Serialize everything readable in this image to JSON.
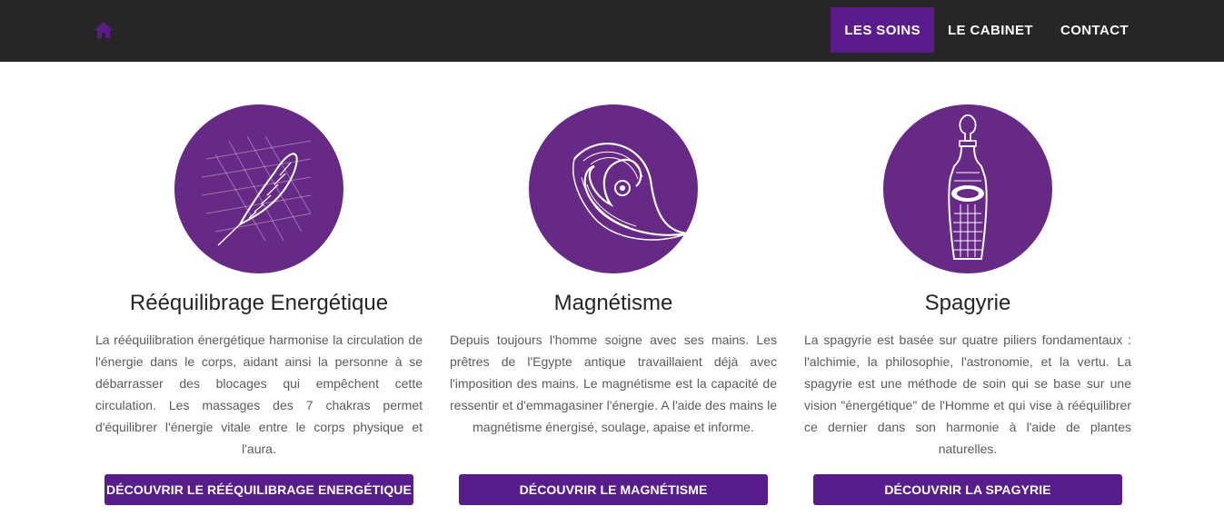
{
  "nav": {
    "home_icon": "home-icon",
    "items": [
      {
        "label": "LES SOINS",
        "active": true
      },
      {
        "label": "LE CABINET",
        "active": false
      },
      {
        "label": "CONTACT",
        "active": false
      }
    ],
    "active_color": "#5a1c8c",
    "background": "#262626"
  },
  "cards": [
    {
      "icon": "feather-icon",
      "title": "Rééquilibrage Energétique",
      "text": "La rééquilibration énergétique harmonise la circulation de l'énergie dans le corps, aidant ainsi la personne à se débarrasser des blocages qui empêchent cette circulation. Les massages des 7 chakras permet d'équilibrer l'énergie vitale entre le corps physique et l'aura.",
      "button": "DÉCOUVRIR LE RÉÉQUILIBRAGE ENERGÉTIQUE"
    },
    {
      "icon": "wave-spiral-icon",
      "title": "Magnétisme",
      "text": "Depuis toujours l'homme soigne avec ses mains. Les prêtres de l'Egypte antique travaillaient déjà avec l'imposition des mains. Le magnétisme est la capacité de ressentir et d'emmagasiner l'énergie. A l'aide des mains le magnétisme énergisé, soulage, apaise et informe.",
      "button": "DÉCOUVRIR LE MAGNÉTISME"
    },
    {
      "icon": "bottle-icon",
      "title": "Spagyrie",
      "text": "La spagyrie est basée sur quatre piliers fondamentaux : l'alchimie, la philosophie, l'astronomie, et la vertu. La spagyrie est une méthode de soin qui se base sur une vision \"énergétique\" de l'Homme et qui vise à rééquilibrer ce dernier dans son harmonie à l'aide de plantes naturelles.",
      "button": "DÉCOUVRIR LA SPAGYRIE"
    }
  ],
  "colors": {
    "accent": "#581d8d",
    "circle": "#662a86",
    "title": "#262626",
    "text": "#5b5b5b"
  }
}
